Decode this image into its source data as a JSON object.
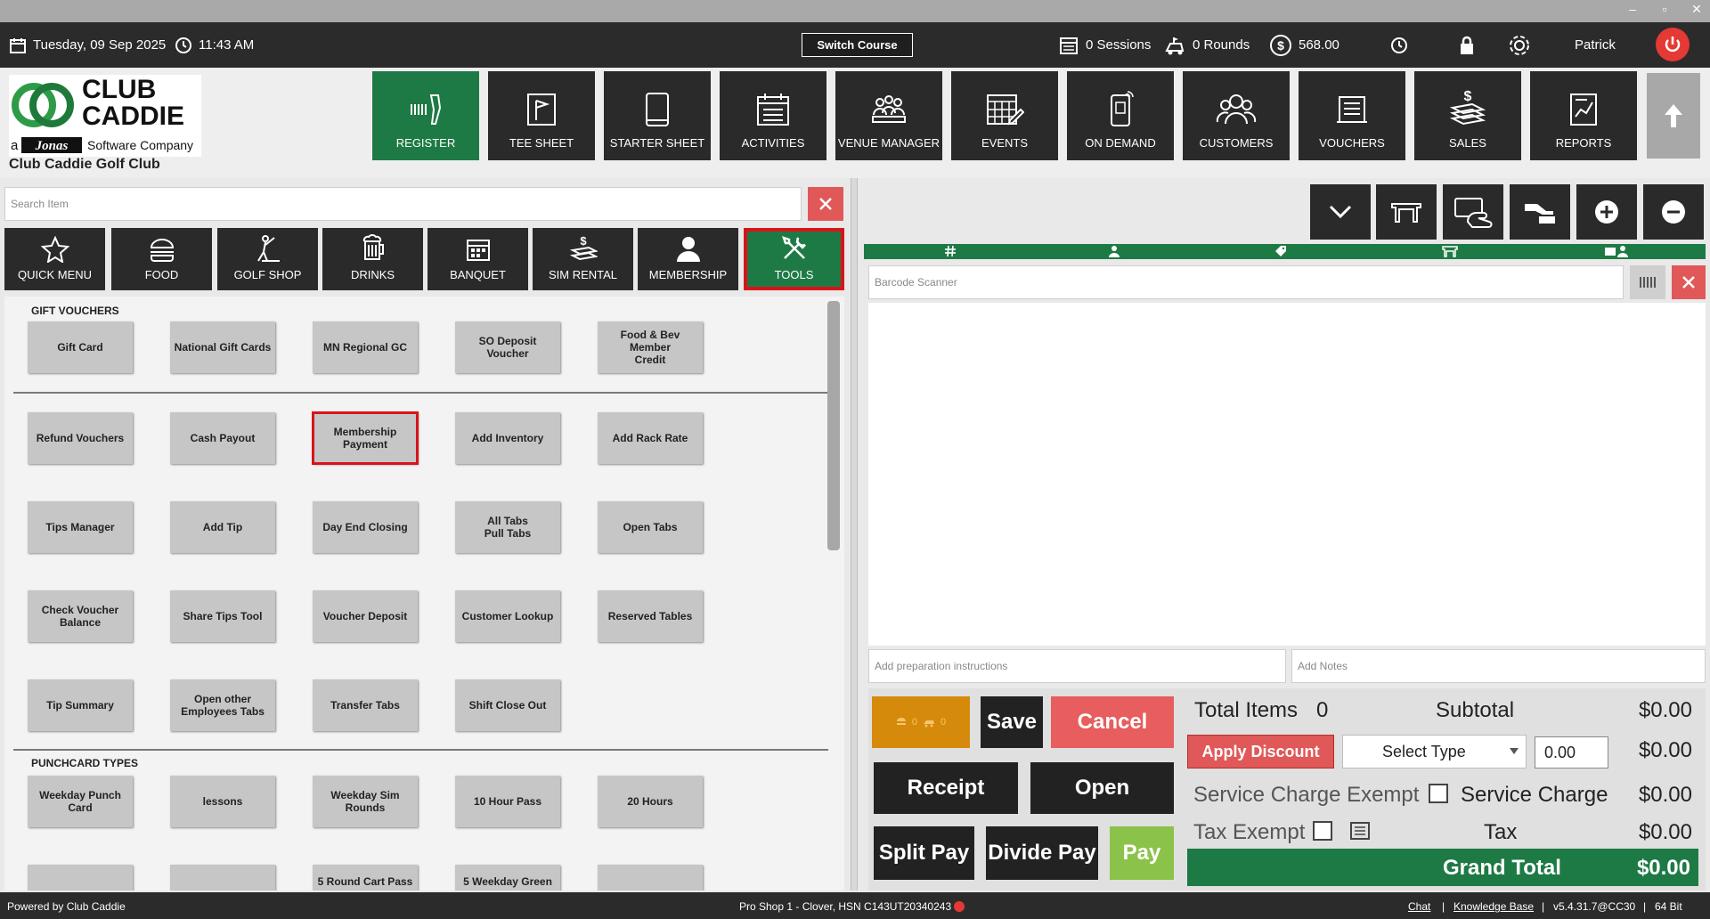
{
  "window": {
    "minimize": "–",
    "restore": "▫",
    "close": "✕"
  },
  "topbar": {
    "date": "Tuesday,  09 Sep 2025",
    "time": "11:43 AM",
    "switch_course": "Switch Course",
    "sessions": "0 Sessions",
    "rounds": "0 Rounds",
    "balance": "568.00",
    "user": "Patrick"
  },
  "logo": {
    "line1": "CLUB",
    "line2": "CADDIE",
    "tagline_a": "a",
    "tagline_brand": "Jonas",
    "tagline_rest": "Software Company"
  },
  "club_name": "Club Caddie Golf Club",
  "nav": [
    {
      "label": "REGISTER",
      "icon": "barcode-scanner-icon"
    },
    {
      "label": "TEE SHEET",
      "icon": "flag-sheet-icon"
    },
    {
      "label": "STARTER SHEET",
      "icon": "tablet-icon"
    },
    {
      "label": "ACTIVITIES",
      "icon": "calendar-list-icon"
    },
    {
      "label": "VENUE MANAGER",
      "icon": "people-table-icon"
    },
    {
      "label": "EVENTS",
      "icon": "calendar-edit-icon"
    },
    {
      "label": "ON DEMAND",
      "icon": "mobile-signal-icon"
    },
    {
      "label": "CUSTOMERS",
      "icon": "group-icon"
    },
    {
      "label": "VOUCHERS",
      "icon": "voucher-icon"
    },
    {
      "label": "SALES",
      "icon": "money-stack-icon"
    },
    {
      "label": "REPORTS",
      "icon": "report-chart-icon"
    }
  ],
  "search": {
    "placeholder": "Search Item"
  },
  "categories": [
    {
      "label": "QUICK MENU",
      "icon": "star-icon"
    },
    {
      "label": "FOOD",
      "icon": "burger-icon"
    },
    {
      "label": "GOLF SHOP",
      "icon": "golfer-icon"
    },
    {
      "label": "DRINKS",
      "icon": "beer-icon"
    },
    {
      "label": "BANQUET",
      "icon": "calendar-icon"
    },
    {
      "label": "SIM RENTAL",
      "icon": "sim-icon"
    },
    {
      "label": "MEMBERSHIP",
      "icon": "person-icon"
    },
    {
      "label": "TOOLS",
      "icon": "tools-icon"
    }
  ],
  "items": {
    "section_gift_vouchers": "GIFT VOUCHERS",
    "gift_vouchers": [
      "Gift Card",
      "National Gift Cards",
      "MN Regional GC",
      "SO Deposit Voucher",
      "Food & Bev Member\nCredit"
    ],
    "tools_row1": [
      "Refund Vouchers",
      "Cash Payout",
      "Membership Payment",
      "Add Inventory",
      "Add Rack Rate"
    ],
    "tools_row2": [
      "Tips Manager",
      "Add Tip",
      "Day End Closing",
      "All Tabs\nPull Tabs",
      "Open Tabs"
    ],
    "tools_row3": [
      "Check Voucher\nBalance",
      "Share Tips Tool",
      "Voucher Deposit",
      "Customer Lookup",
      "Reserved Tables"
    ],
    "tools_row4": [
      "Tip Summary",
      "Open other\nEmployees Tabs",
      "Transfer Tabs",
      "Shift Close Out"
    ],
    "section_punchcard": "PUNCHCARD TYPES",
    "punchcard_row1": [
      "Weekday Punch Card",
      "lessons",
      "Weekday Sim Rounds",
      "10 Hour Pass",
      "20 Hours"
    ],
    "punchcard_row2": [
      "",
      "",
      "5 Round Cart Pass -",
      "5 Weekday Green",
      ""
    ]
  },
  "order": {
    "barcode_placeholder": "Barcode Scanner",
    "prep_placeholder": "Add preparation instructions",
    "notes_placeholder": "Add Notes",
    "counter_a": "0",
    "counter_b": "0",
    "save": "Save",
    "cancel": "Cancel",
    "receipt": "Receipt",
    "open": "Open",
    "split_pay": "Split Pay",
    "divide_pay": "Divide Pay",
    "pay": "Pay",
    "total_items_label": "Total Items",
    "total_items": "0",
    "subtotal_label": "Subtotal",
    "subtotal": "$0.00",
    "apply_discount": "Apply Discount",
    "select_type": "Select Type",
    "discount_value": "0.00",
    "discount_amount": "$0.00",
    "service_charge_exempt": "Service Charge Exempt",
    "service_charge_label": "Service Charge",
    "service_charge": "$0.00",
    "tax_exempt": "Tax Exempt",
    "tax_label": "Tax",
    "tax": "$0.00",
    "grand_total_label": "Grand Total",
    "grand_total": "$0.00"
  },
  "footer": {
    "powered": "Powered by Club Caddie",
    "device": "Pro Shop 1 - Clover, HSN C143UT20340243",
    "chat": "Chat",
    "sep1": "|",
    "kb": "Knowledge Base",
    "sep2": "|",
    "version": "v5.4.31.7@CC30",
    "sep3": "|",
    "bits": "64 Bit"
  },
  "colors": {
    "accent_green": "#1e7a45",
    "danger_red": "#e05858",
    "dark": "#2a2a2a",
    "highlight": "#d8141a",
    "pay_green": "#8bc34a",
    "counter_orange": "#d68a0c"
  }
}
